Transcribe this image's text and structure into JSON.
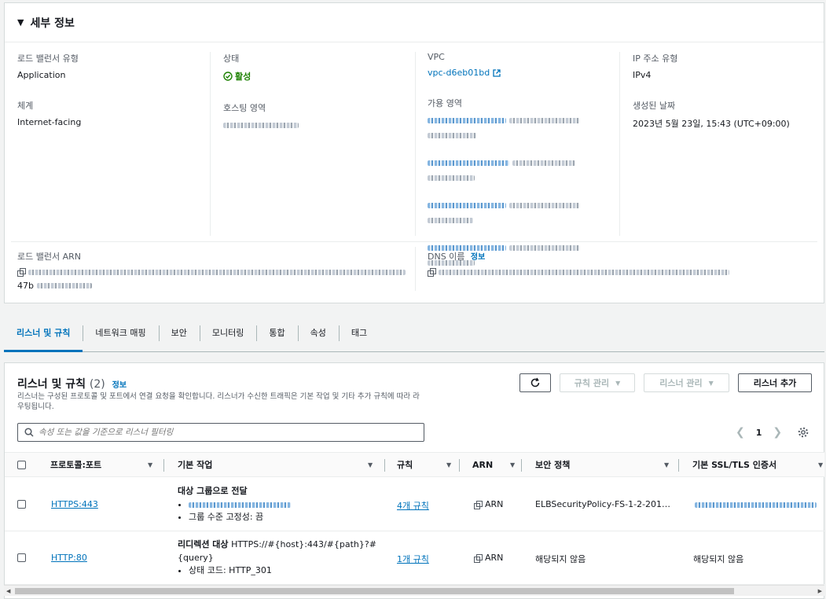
{
  "details": {
    "title": "세부 정보",
    "lb_type_label": "로드 밸런서 유형",
    "lb_type_value": "Application",
    "scheme_label": "체계",
    "scheme_value": "Internet-facing",
    "state_label": "상태",
    "state_value": "활성",
    "hosted_zone_label": "호스팅 영역",
    "vpc_label": "VPC",
    "vpc_value": "vpc-d6eb01bd",
    "az_label": "가용 영역",
    "ip_type_label": "IP 주소 유형",
    "ip_type_value": "IPv4",
    "created_label": "생성된 날짜",
    "created_value": "2023년 5월 23일, 15:43 (UTC+09:00)",
    "arn_label": "로드 밸런서 ARN",
    "arn_suffix": "47b",
    "dns_label": "DNS 이름",
    "dns_info": "정보"
  },
  "tabs": [
    "리스너 및 규칙",
    "네트워크 매핑",
    "보안",
    "모니터링",
    "통합",
    "속성",
    "태그"
  ],
  "listeners": {
    "title": "리스너 및 규칙",
    "count": "(2)",
    "info": "정보",
    "description": "리스너는 구성된 프로토콜 및 포트에서 연결 요청을 확인합니다. 리스너가 수신한 트래픽은 기본 작업 및 기타 추가 규칙에 따라 라우팅됩니다.",
    "manage_rules": "규칙 관리",
    "manage_listener": "리스너 관리",
    "add_listener": "리스너 추가",
    "search_placeholder": "속성 또는 값을 기준으로 리스너 필터링",
    "page": "1",
    "columns": {
      "protocol": "프로토콜:포트",
      "action": "기본 작업",
      "rules": "규칙",
      "arn": "ARN",
      "policy": "보안 정책",
      "cert": "기본 SSL/TLS 인증서"
    },
    "rows": [
      {
        "protocol": "HTTPS:443",
        "action_title": "대상 그룹으로 전달",
        "action_sub": "그룹 수준 고정성: 끔",
        "rules": "4개 규칙",
        "arn": "ARN",
        "policy": "ELBSecurityPolicy-FS-1-2-201…",
        "cert": ""
      },
      {
        "protocol": "HTTP:80",
        "action_title": "리디렉션 대상",
        "action_target": "HTTPS://#{host}:443/#{path}?#",
        "action_target2": "{query}",
        "action_sub": "상태 코드: HTTP_301",
        "rules": "1개 규칙",
        "arn": "ARN",
        "policy": "해당되지 않음",
        "cert": "해당되지 않음"
      }
    ]
  },
  "colors": {
    "accent": "#0073bb",
    "success": "#1d8102",
    "border": "#d5dbdb"
  }
}
